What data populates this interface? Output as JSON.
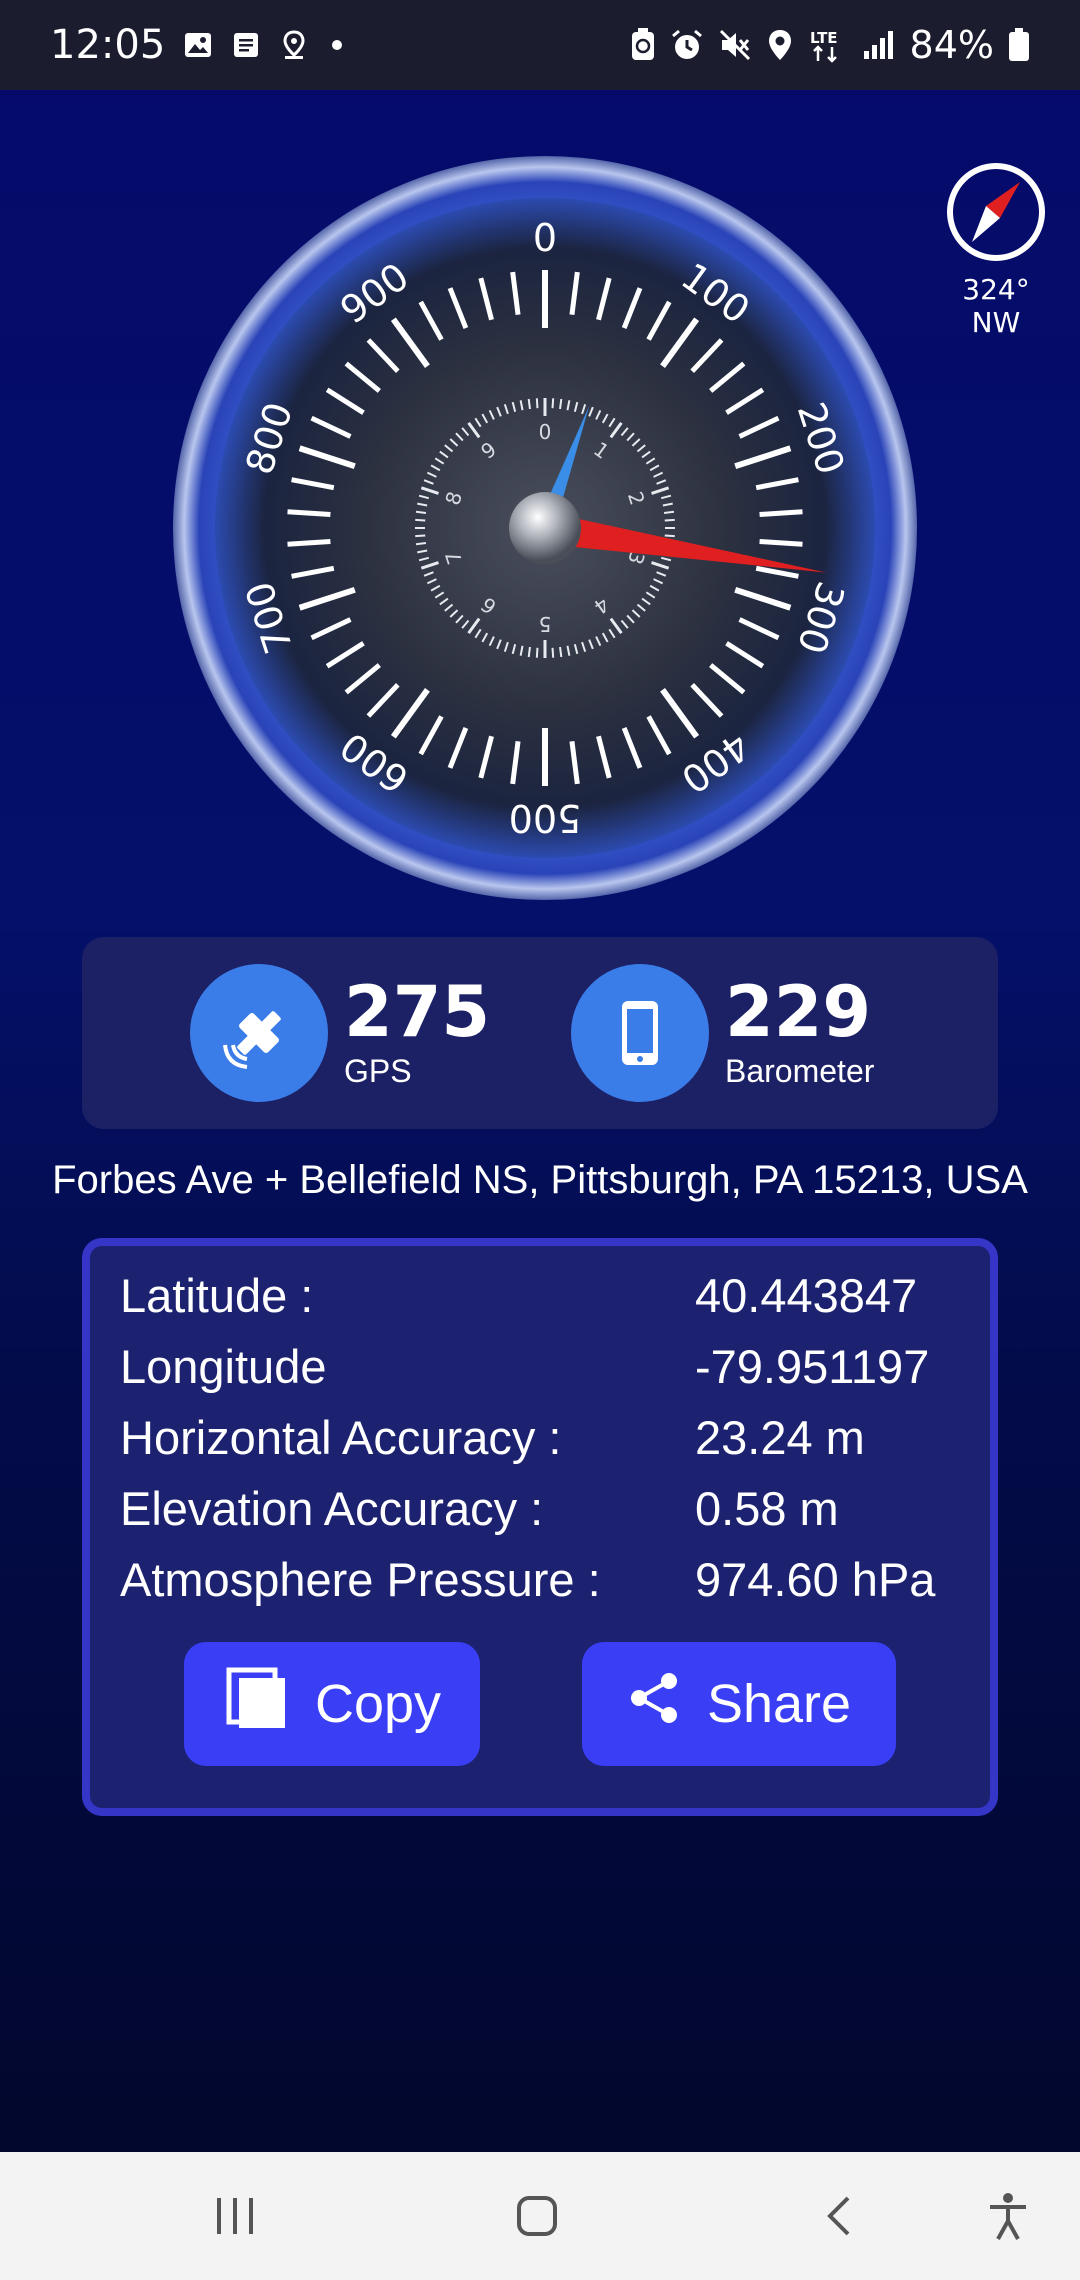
{
  "status_bar": {
    "time": "12:05",
    "battery": "84%",
    "left_icons": [
      "image-icon",
      "note-icon",
      "location-pin-icon",
      "dot-icon"
    ],
    "right_icons": [
      "battery-saver-icon",
      "alarm-icon",
      "mute-icon",
      "location-icon",
      "lte-icon",
      "signal-icon",
      "battery-icon"
    ]
  },
  "gauge": {
    "outer_scale": [
      "0",
      "100",
      "200",
      "300",
      "400",
      "500",
      "600",
      "700",
      "800",
      "900"
    ],
    "inner_scale": [
      "0",
      "1",
      "2",
      "3",
      "4",
      "5",
      "6",
      "7",
      "8",
      "9"
    ],
    "reading": 275
  },
  "compass": {
    "heading": "324° NW"
  },
  "stats": {
    "gps": {
      "value": "275",
      "label": "GPS",
      "icon": "satellite-icon"
    },
    "barometer": {
      "value": "229",
      "label": "Barometer",
      "icon": "phone-icon"
    }
  },
  "address": "Forbes Ave + Bellefield NS, Pittsburgh, PA 15213, USA",
  "info": {
    "rows": [
      {
        "key": "Latitude :",
        "value": "40.443847"
      },
      {
        "key": "Longitude",
        "value": "-79.951197"
      },
      {
        "key": "Horizontal Accuracy :",
        "value": "23.24  m"
      },
      {
        "key": "Elevation Accuracy :",
        "value": "0.58  m"
      },
      {
        "key": "Atmosphere Pressure :",
        "value": "974.60 hPa"
      }
    ],
    "copy_label": "Copy",
    "share_label": "Share"
  },
  "colors": {
    "accent_blue": "#3a7de8",
    "button_blue": "#3a3ef5",
    "needle_red": "#e02020",
    "needle_blue": "#3a8ee8"
  }
}
